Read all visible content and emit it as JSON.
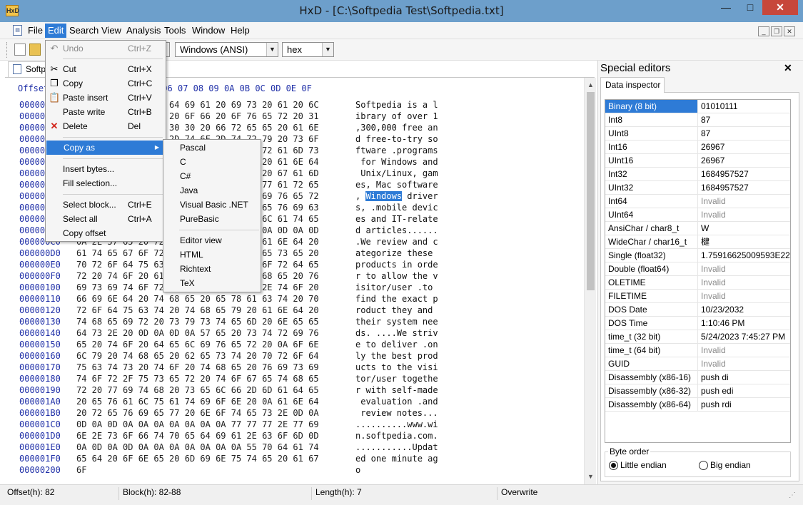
{
  "window": {
    "title": "HxD - [C:\\Softpedia Test\\Softpedia.txt]",
    "app_icon": "HxD",
    "min": "—",
    "max": "□",
    "close": "✕"
  },
  "menubar": [
    "File",
    "Edit",
    "Search",
    "View",
    "Analysis",
    "Tools",
    "Window",
    "Help"
  ],
  "toolbar": {
    "encoding": "Windows (ANSI)",
    "view_mode": "hex"
  },
  "doc_tab": "Softpedia.txt",
  "hex": {
    "header": "Offset(h) 00 01 02 03 04 05 06 07 08 09 0A 0B 0C 0D 0E 0F",
    "rows": [
      {
        "o": "00000000",
        "h": "53 6F 66 74 70 65 64 69 61 20 69 73 20 61 20 6C",
        "t": "Softpedia is a l"
      },
      {
        "o": "00000010",
        "h": "69 62 72 61 72 79 20 6F 66 20 6F 76 65 72 20 31",
        "t": "ibrary of over 1"
      },
      {
        "o": "00000020",
        "h": "2C 33 30 30 2C 30 30 30 20 66 72 65 65 20 61 6E",
        "t": ",300,000 free an"
      },
      {
        "o": "00000030",
        "h": "64 20 66 72 65 65 2D 74 6F 2D 74 72 79 20 73 6F",
        "t": "d free-to-try so"
      },
      {
        "o": "00000040",
        "h": "66 74 77 61 72 65 20 2E 70 72 6F 67 72 61 6D 73",
        "t": "ftware .programs"
      },
      {
        "o": "00000050",
        "h": "20 66 6F 72 20 57 69 6E 64 6F 77 73 20 61 6E 64",
        "t": " for Windows and"
      },
      {
        "o": "00000060",
        "h": "20 55 6E 69 78 2F 4C 69 6E 75 78 2C 20 67 61 6D",
        "t": " Unix/Linux, gam"
      },
      {
        "o": "00000070",
        "h": "65 73 2C 20 4D 61 63 20 73 6F 66 74 77 61 72 65",
        "t": "es, Mac software"
      },
      {
        "o": "00000080",
        "h": "2C 20 57 69 6E 64 6F 77 73 20 64 72 69 76 65 72",
        "t": ", Windows driver"
      },
      {
        "o": "00000090",
        "h": "73 2C 20 2E 6D 6F 62 69 6C 65 20 64 65 76 69 63",
        "t": "s, .mobile devic"
      },
      {
        "o": "000000A0",
        "h": "65 73 20 61 6E 64 20 49 54 2D 72 65 6C 61 74 65",
        "t": "es and IT-relate"
      },
      {
        "o": "000000B0",
        "h": "64 20 61 72 74 69 63 6C 65 73 0D 0A 0A 0D 0A 0D",
        "t": "d articles......"
      },
      {
        "o": "000000C0",
        "h": "0A 2E 57 65 20 72 65 76 69 65 77 20 61 6E 64 20",
        "t": ".We review and c"
      },
      {
        "o": "000000D0",
        "h": "61 74 65 67 6F 72 69 7A 65 20 74 68 65 73 65 20",
        "t": "ategorize these "
      },
      {
        "o": "000000E0",
        "h": "70 72 6F 64 75 63 74 73 20 69 6E 20 6F 72 64 65",
        "t": "products in orde"
      },
      {
        "o": "000000F0",
        "h": "72 20 74 6F 20 61 6C 6C 6F 77 20 74 68 65 20 76",
        "t": "r to allow the v"
      },
      {
        "o": "00000100",
        "h": "69 73 69 74 6F 72 2F 75 73 65 72 20 2E 74 6F 20",
        "t": "isitor/user .to "
      },
      {
        "o": "00000110",
        "h": "66 69 6E 64 20 74 68 65 20 65 78 61 63 74 20 70",
        "t": "find the exact p"
      },
      {
        "o": "00000120",
        "h": "72 6F 64 75 63 74 20 74 68 65 79 20 61 6E 64 20",
        "t": "roduct they and "
      },
      {
        "o": "00000130",
        "h": "74 68 65 69 72 20 73 79 73 74 65 6D 20 6E 65 65",
        "t": "their system nee"
      },
      {
        "o": "00000140",
        "h": "64 73 2E 20 0D 0A 0D 0A 57 65 20 73 74 72 69 76",
        "t": "ds. ....We striv"
      },
      {
        "o": "00000150",
        "h": "65 20 74 6F 20 64 65 6C 69 76 65 72 20 0A 6F 6E",
        "t": "e to deliver .on"
      },
      {
        "o": "00000160",
        "h": "6C 79 20 74 68 65 20 62 65 73 74 20 70 72 6F 64",
        "t": "ly the best prod"
      },
      {
        "o": "00000170",
        "h": "75 63 74 73 20 74 6F 20 74 68 65 20 76 69 73 69",
        "t": "ucts to the visi"
      },
      {
        "o": "00000180",
        "h": "74 6F 72 2F 75 73 65 72 20 74 6F 67 65 74 68 65",
        "t": "tor/user togethe"
      },
      {
        "o": "00000190",
        "h": "72 20 77 69 74 68 20 73 65 6C 66 2D 6D 61 64 65",
        "t": "r with self-made"
      },
      {
        "o": "000001A0",
        "h": "20 65 76 61 6C 75 61 74 69 6F 6E 20 0A 61 6E 64",
        "t": " evaluation .and"
      },
      {
        "o": "000001B0",
        "h": "20 72 65 76 69 65 77 20 6E 6F 74 65 73 2E 0D 0A",
        "t": " review notes..."
      },
      {
        "o": "000001C0",
        "h": "0D 0A 0D 0A 0A 0A 0A 0A 0A 0A 77 77 77 2E 77 69",
        "t": "..........www.wi"
      },
      {
        "o": "000001D0",
        "h": "6E 2E 73 6F 66 74 70 65 64 69 61 2E 63 6F 6D 0D",
        "t": "n.softpedia.com."
      },
      {
        "o": "000001E0",
        "h": "0A 0D 0A 0D 0A 0A 0A 0A 0A 0A 0A 55 70 64 61 74",
        "t": "...........Updat"
      },
      {
        "o": "000001F0",
        "h": "65 64 20 6F 6E 65 20 6D 69 6E 75 74 65 20 61 67",
        "t": "ed one minute ag"
      },
      {
        "o": "00000200",
        "h": "6F",
        "t": "o"
      }
    ],
    "highlight_word": "Windows"
  },
  "edit_menu": [
    {
      "label": "Undo",
      "shortcut": "Ctrl+Z",
      "disabled": true,
      "icon": "undo-icon"
    },
    {
      "label": "Cut",
      "shortcut": "Ctrl+X",
      "icon": "scissors-icon"
    },
    {
      "label": "Copy",
      "shortcut": "Ctrl+C",
      "icon": "copy-icon"
    },
    {
      "label": "Paste insert",
      "shortcut": "Ctrl+V",
      "icon": "paste-icon"
    },
    {
      "label": "Paste write",
      "shortcut": "Ctrl+B"
    },
    {
      "label": "Delete",
      "shortcut": "Del",
      "icon": "delete-x-icon"
    },
    {
      "label": "Copy as",
      "shortcut": ""
    },
    {
      "label": "Insert bytes...",
      "shortcut": ""
    },
    {
      "label": "Fill selection...",
      "shortcut": ""
    },
    {
      "label": "Select block...",
      "shortcut": "Ctrl+E"
    },
    {
      "label": "Select all",
      "shortcut": "Ctrl+A"
    },
    {
      "label": "Copy offset",
      "shortcut": ""
    }
  ],
  "copy_as_menu": [
    "Pascal",
    "C",
    "C#",
    "Java",
    "Visual Basic .NET",
    "PureBasic",
    "Editor view",
    "HTML",
    "Richtext",
    "TeX"
  ],
  "special_editors": {
    "title": "Special editors",
    "tab": "Data inspector",
    "rows": [
      {
        "k": "Binary (8 bit)",
        "v": "01010111"
      },
      {
        "k": "Int8",
        "v": "87"
      },
      {
        "k": "UInt8",
        "v": "87"
      },
      {
        "k": "Int16",
        "v": "26967"
      },
      {
        "k": "UInt16",
        "v": "26967"
      },
      {
        "k": "Int32",
        "v": "1684957527"
      },
      {
        "k": "UInt32",
        "v": "1684957527"
      },
      {
        "k": "Int64",
        "v": "Invalid"
      },
      {
        "k": "UInt64",
        "v": "Invalid"
      },
      {
        "k": "AnsiChar / char8_t",
        "v": "W"
      },
      {
        "k": "WideChar / char16_t",
        "v": "楗"
      },
      {
        "k": "Single (float32)",
        "v": "1.75916625009593E22"
      },
      {
        "k": "Double (float64)",
        "v": "Invalid"
      },
      {
        "k": "OLETIME",
        "v": "Invalid"
      },
      {
        "k": "FILETIME",
        "v": "Invalid"
      },
      {
        "k": "DOS Date",
        "v": "10/23/2032"
      },
      {
        "k": "DOS Time",
        "v": "1:10:46 PM"
      },
      {
        "k": "time_t (32 bit)",
        "v": "5/24/2023 7:45:27 PM"
      },
      {
        "k": "time_t (64 bit)",
        "v": "Invalid"
      },
      {
        "k": "GUID",
        "v": "Invalid"
      },
      {
        "k": "Disassembly (x86-16)",
        "v": "push di"
      },
      {
        "k": "Disassembly (x86-32)",
        "v": "push edi"
      },
      {
        "k": "Disassembly (x86-64)",
        "v": "push rdi"
      }
    ],
    "byte_order_label": "Byte order",
    "little_endian": "Little endian",
    "big_endian": "Big endian"
  },
  "statusbar": {
    "offset": "Offset(h): 82",
    "block": "Block(h): 82-88",
    "length": "Length(h): 7",
    "mode": "Overwrite"
  },
  "colors": {
    "selection": "#2e7bd6",
    "offset_blue": "#2030a8",
    "titlebar": "#6d9fcb"
  }
}
